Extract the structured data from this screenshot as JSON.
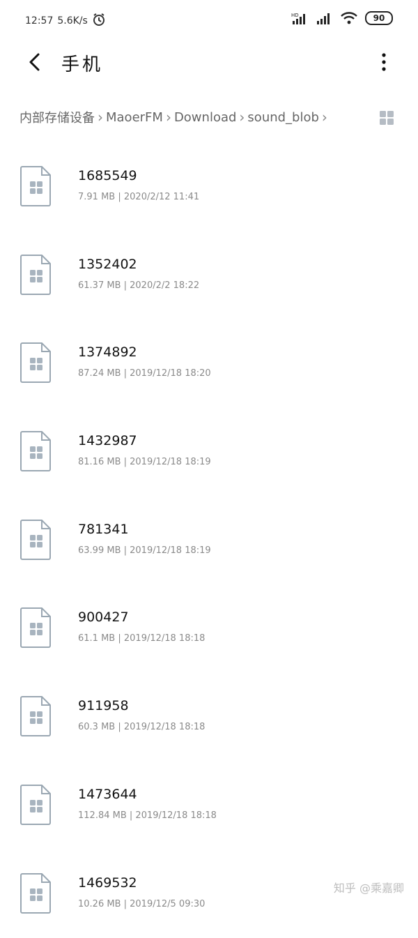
{
  "status": {
    "time": "12:57",
    "speed": "5.6K/s",
    "battery": "90"
  },
  "header": {
    "title": "手机"
  },
  "breadcrumb": [
    "内部存储设备",
    "MaoerFM",
    "Download",
    "sound_blob"
  ],
  "files": [
    {
      "name": "1685549",
      "size": "7.91 MB",
      "date": "2020/2/12 11:41"
    },
    {
      "name": "1352402",
      "size": "61.37 MB",
      "date": "2020/2/2 18:22"
    },
    {
      "name": "1374892",
      "size": "87.24 MB",
      "date": "2019/12/18 18:20"
    },
    {
      "name": "1432987",
      "size": "81.16 MB",
      "date": "2019/12/18 18:19"
    },
    {
      "name": "781341",
      "size": "63.99 MB",
      "date": "2019/12/18 18:19"
    },
    {
      "name": "900427",
      "size": "61.1 MB",
      "date": "2019/12/18 18:18"
    },
    {
      "name": "911958",
      "size": "60.3 MB",
      "date": "2019/12/18 18:18"
    },
    {
      "name": "1473644",
      "size": "112.84 MB",
      "date": "2019/12/18 18:18"
    },
    {
      "name": "1469532",
      "size": "10.26 MB",
      "date": "2019/12/5 09:30"
    }
  ],
  "watermark": "知乎 @乘嘉卿",
  "icons": {
    "back": "chevron-left-icon",
    "more": "more-vertical-icon",
    "view": "grid-view-icon",
    "file": "file-icon"
  },
  "colors": {
    "icon_stroke": "#9aa7b2",
    "icon_fill": "#a8b4bf",
    "text_meta": "#8a8a8a"
  }
}
